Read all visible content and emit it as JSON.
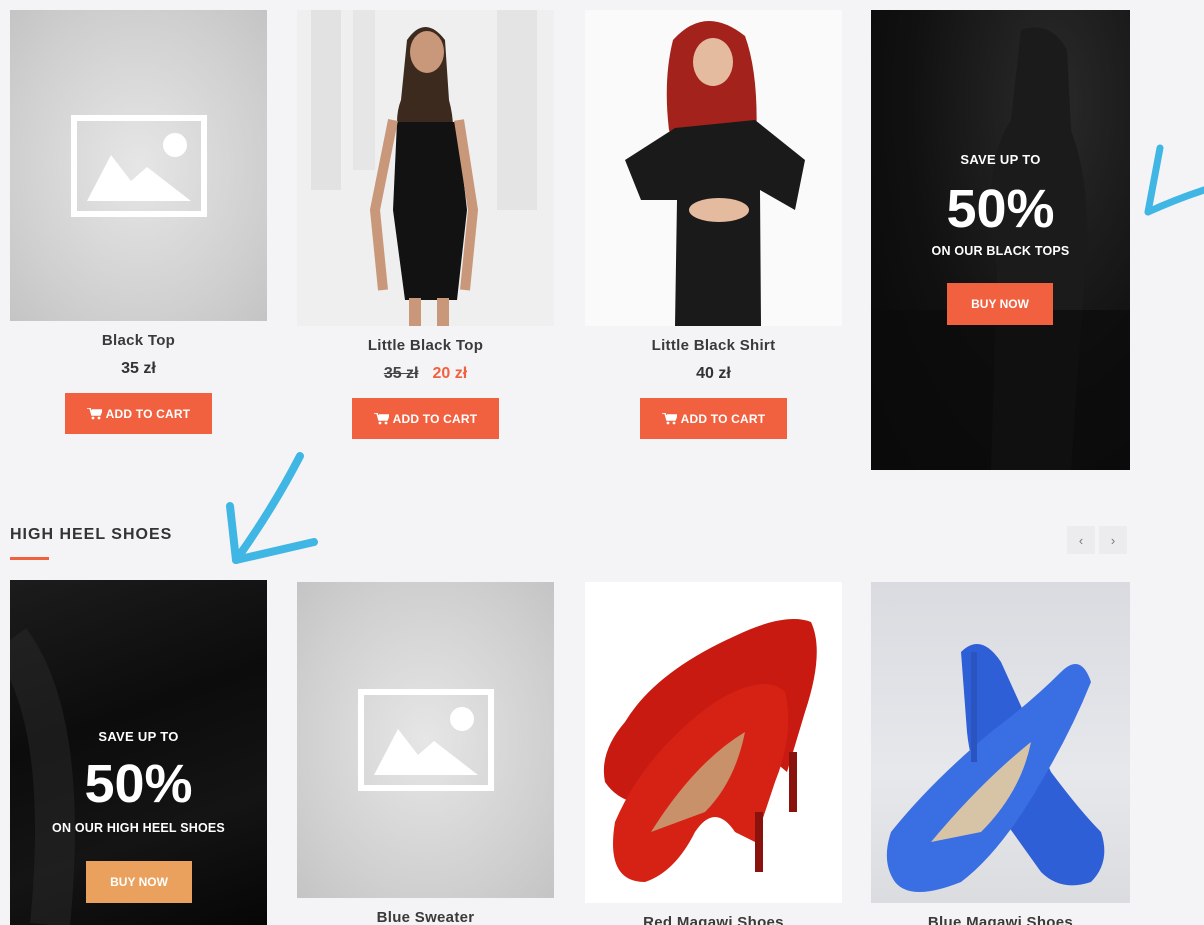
{
  "products_row1": [
    {
      "name": "Black Top",
      "price": "35 zł",
      "cart_label": "ADD TO CART"
    },
    {
      "name": "Little Black Top",
      "old_price": "35 zł",
      "new_price": "20 zł",
      "cart_label": "ADD TO CART"
    },
    {
      "name": "Little Black Shirt",
      "price": "40 zł",
      "cart_label": "ADD TO CART"
    }
  ],
  "promo_tops": {
    "save": "SAVE UP TO",
    "percent": "50%",
    "subtitle": "ON OUR BLACK TOPS",
    "button": "BUY NOW"
  },
  "section": {
    "title": "HIGH HEEL SHOES",
    "prev": "‹",
    "next": "›"
  },
  "promo_shoes": {
    "save": "SAVE UP TO",
    "percent": "50%",
    "subtitle": "ON OUR HIGH HEEL SHOES",
    "button": "BUY NOW"
  },
  "products_row2": [
    {
      "name": "Blue Sweater"
    },
    {
      "name": "Red Magawi Shoes"
    },
    {
      "name": "Blue Magawi Shoes"
    }
  ],
  "colors": {
    "accent": "#f1613f",
    "buy_orange": "#f1613f",
    "buy_tan": "#e9a15d",
    "annotation_arrow": "#3fb6e4"
  }
}
